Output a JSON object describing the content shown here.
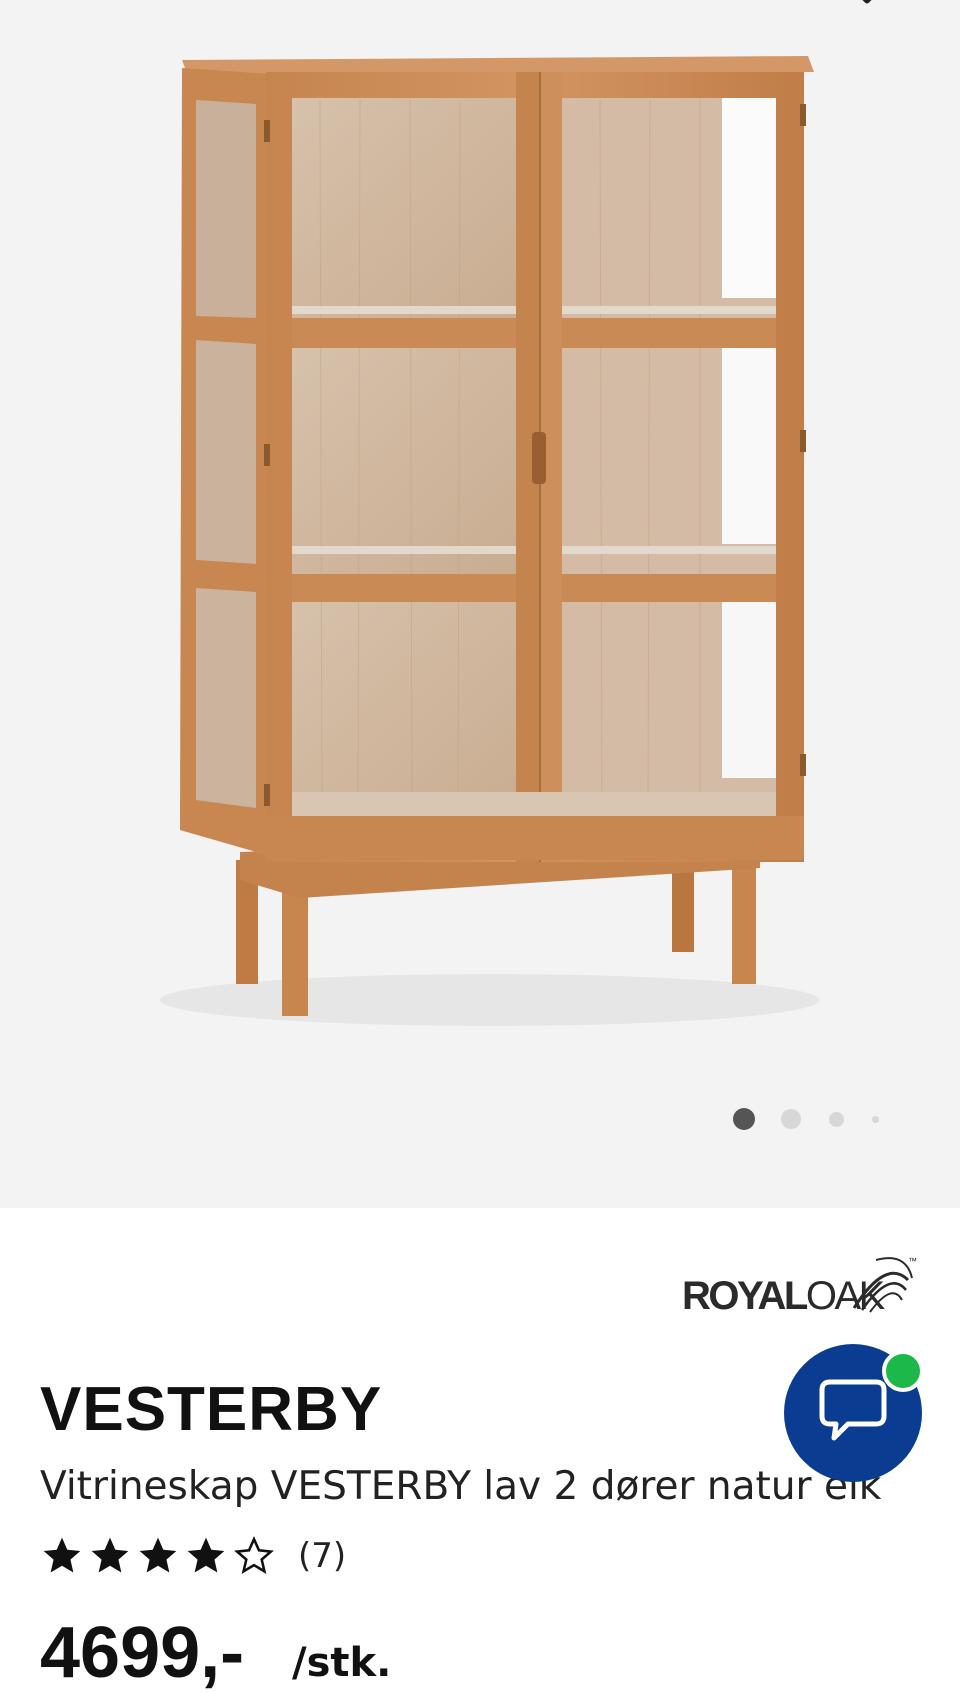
{
  "gallery": {
    "image_name": "vitrineskap-vesterby-image",
    "page_count": 4,
    "active_page": 1
  },
  "brand": {
    "name_bold": "ROYAL",
    "name_light": "OAK",
    "trademark": "™"
  },
  "product": {
    "title": "VESTERBY",
    "subtitle": "Vitrineskap VESTERBY lav 2 dører natur eik",
    "rating": 4,
    "rating_max": 5,
    "review_count": "(7)",
    "price": "4699,-",
    "unit": "/stk."
  },
  "chat": {
    "icon": "chat-bubble-icon",
    "status": "online",
    "status_color": "#1db84a",
    "button_color": "#0a3d91"
  },
  "colors": {
    "wood": "#c98a55",
    "background": "#f3f3f3"
  }
}
